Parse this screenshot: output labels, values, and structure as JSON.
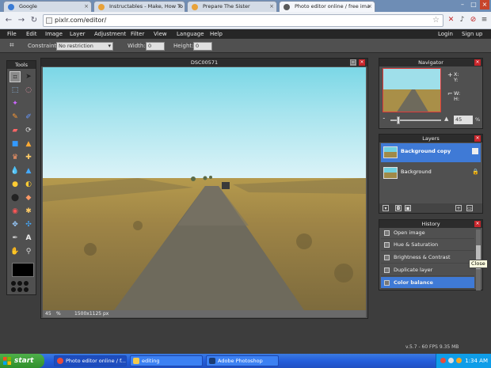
{
  "browser": {
    "tabs": [
      {
        "title": "Google",
        "icon_color": "#3a7bd5"
      },
      {
        "title": "Instructables - Make, How To",
        "icon_color": "#e8a23a"
      },
      {
        "title": "Prepare The Sister",
        "icon_color": "#e8a23a"
      },
      {
        "title": "Photo editor online / free ima",
        "icon_color": "#5a5a5a"
      }
    ],
    "url": "pixlr.com/editor/"
  },
  "menubar": {
    "items": [
      "File",
      "Edit",
      "Image",
      "Layer",
      "Adjustment",
      "Filter",
      "View",
      "Language",
      "Help"
    ],
    "login": "Login",
    "signup": "Sign up"
  },
  "options": {
    "constraint_label": "Constraint:",
    "constraint_value": "No restriction",
    "width_label": "Width:",
    "width_value": "0",
    "height_label": "Height:",
    "height_value": "0"
  },
  "tools_panel": {
    "title": "Tools"
  },
  "document": {
    "title": "DSC00571",
    "zoom": "45",
    "zoom_unit": "%",
    "size": "1500x1125 px"
  },
  "navigator": {
    "title": "Navigator",
    "x_label": "X:",
    "y_label": "Y:",
    "w_label": "W:",
    "h_label": "H:",
    "zoom_value": "45",
    "zoom_unit": "%"
  },
  "layers": {
    "title": "Layers",
    "items": [
      {
        "name": "Background copy",
        "active": true
      },
      {
        "name": "Background",
        "active": false
      }
    ]
  },
  "history": {
    "title": "History",
    "items": [
      "Open image",
      "Hue & Saturation",
      "Brightness & Contrast",
      "Duplicate layer",
      "Color balance"
    ],
    "close_tooltip": "Close"
  },
  "fps_info": "v.5.7 - 60 FPS 9.35 MB",
  "taskbar": {
    "start": "start",
    "buttons": [
      "Photo editor online / f...",
      "editing",
      "Adobe Photoshop"
    ],
    "clock": "1:34 AM"
  },
  "colors": {
    "accent": "#3f7ad6",
    "close_red": "#c7252b",
    "panel_bg": "#505050",
    "menubar_bg": "#262626"
  }
}
